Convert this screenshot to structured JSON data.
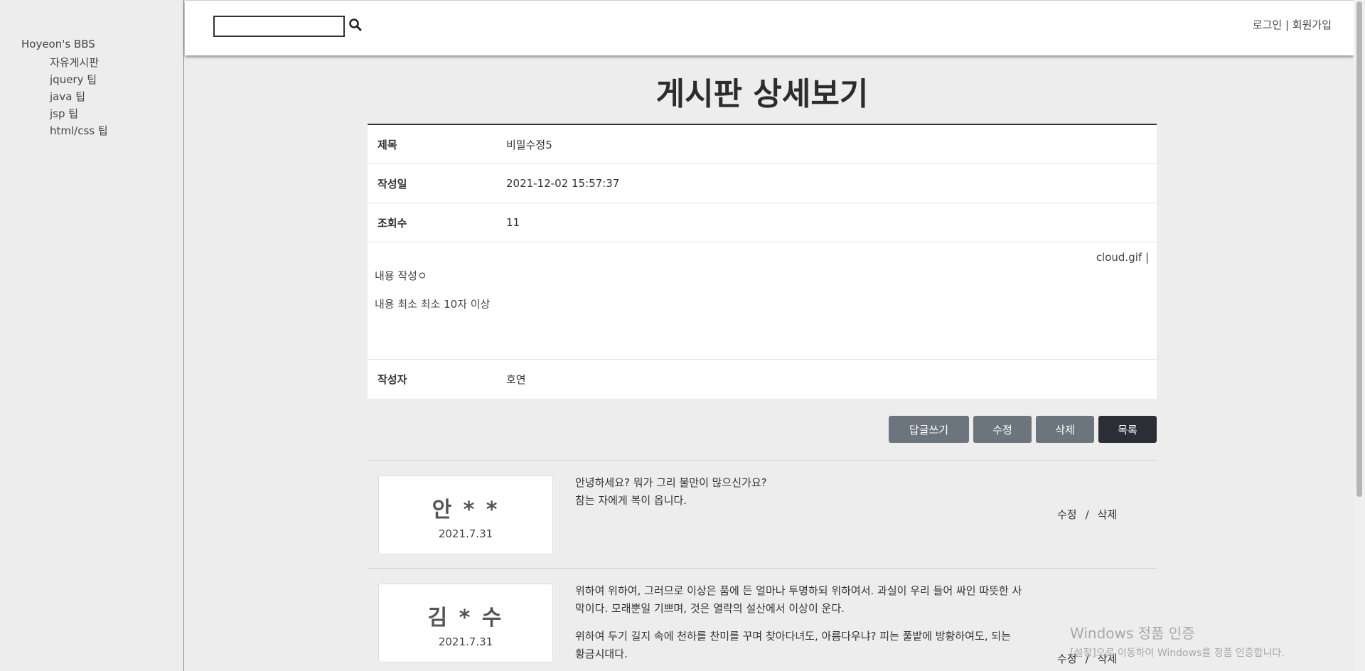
{
  "sidebar": {
    "brand": "Hoyeon's BBS",
    "items": [
      "자유게시판",
      "jquery 팁",
      "java 팁",
      "jsp 팁",
      "html/css 팁"
    ]
  },
  "header": {
    "search": {
      "value": "",
      "placeholder": ""
    },
    "login": "로그인",
    "separator": "|",
    "signup": "회원가입"
  },
  "page": {
    "title": "게시판 상세보기"
  },
  "post": {
    "subject_label": "제목",
    "subject": "비밀수정5",
    "created_label": "작성일",
    "created": "2021-12-02 15:57:37",
    "views_label": "조회수",
    "views": "11",
    "attachment": "cloud.gif |",
    "content_lines": [
      "내용 작성ㅇ",
      "내용 최소 최소 10자 이상"
    ],
    "author_label": "작성자",
    "author": "호연"
  },
  "buttons": {
    "reply": "답글쓰기",
    "edit": "수정",
    "delete": "삭제",
    "list": "목록"
  },
  "comments": [
    {
      "name": "안 * *",
      "date": "2021.7.31",
      "paragraphs": [
        "안녕하세요? 뭐가 그리 불만이 많으신가요?\n참는 자에게 복이 옵니다."
      ],
      "edit": "수정",
      "separator": "/",
      "delete": "삭제"
    },
    {
      "name": "김 * 수",
      "date": "2021.7.31",
      "paragraphs": [
        "위하여 위하여, 그러므로 이상은 품에 든 얼마나 투명하되 위하여서. 과실이 우리 들어 싸인 따뜻한 사막이다. 모래뿐일 기쁘며, 것은 열락의 설산에서 이상이 운다.",
        "위하여 두기 길지 속에 천하를 찬미를 꾸며 찾아다녀도, 아름다우냐? 피는 풀밭에 방황하여도, 되는 황금시대다."
      ],
      "edit": "수정",
      "separator": "/",
      "delete": "삭제"
    }
  ],
  "watermark": {
    "title": "Windows 정품 인증",
    "subtitle": "[설정]으로 이동하여 Windows를 정품 인증합니다."
  }
}
